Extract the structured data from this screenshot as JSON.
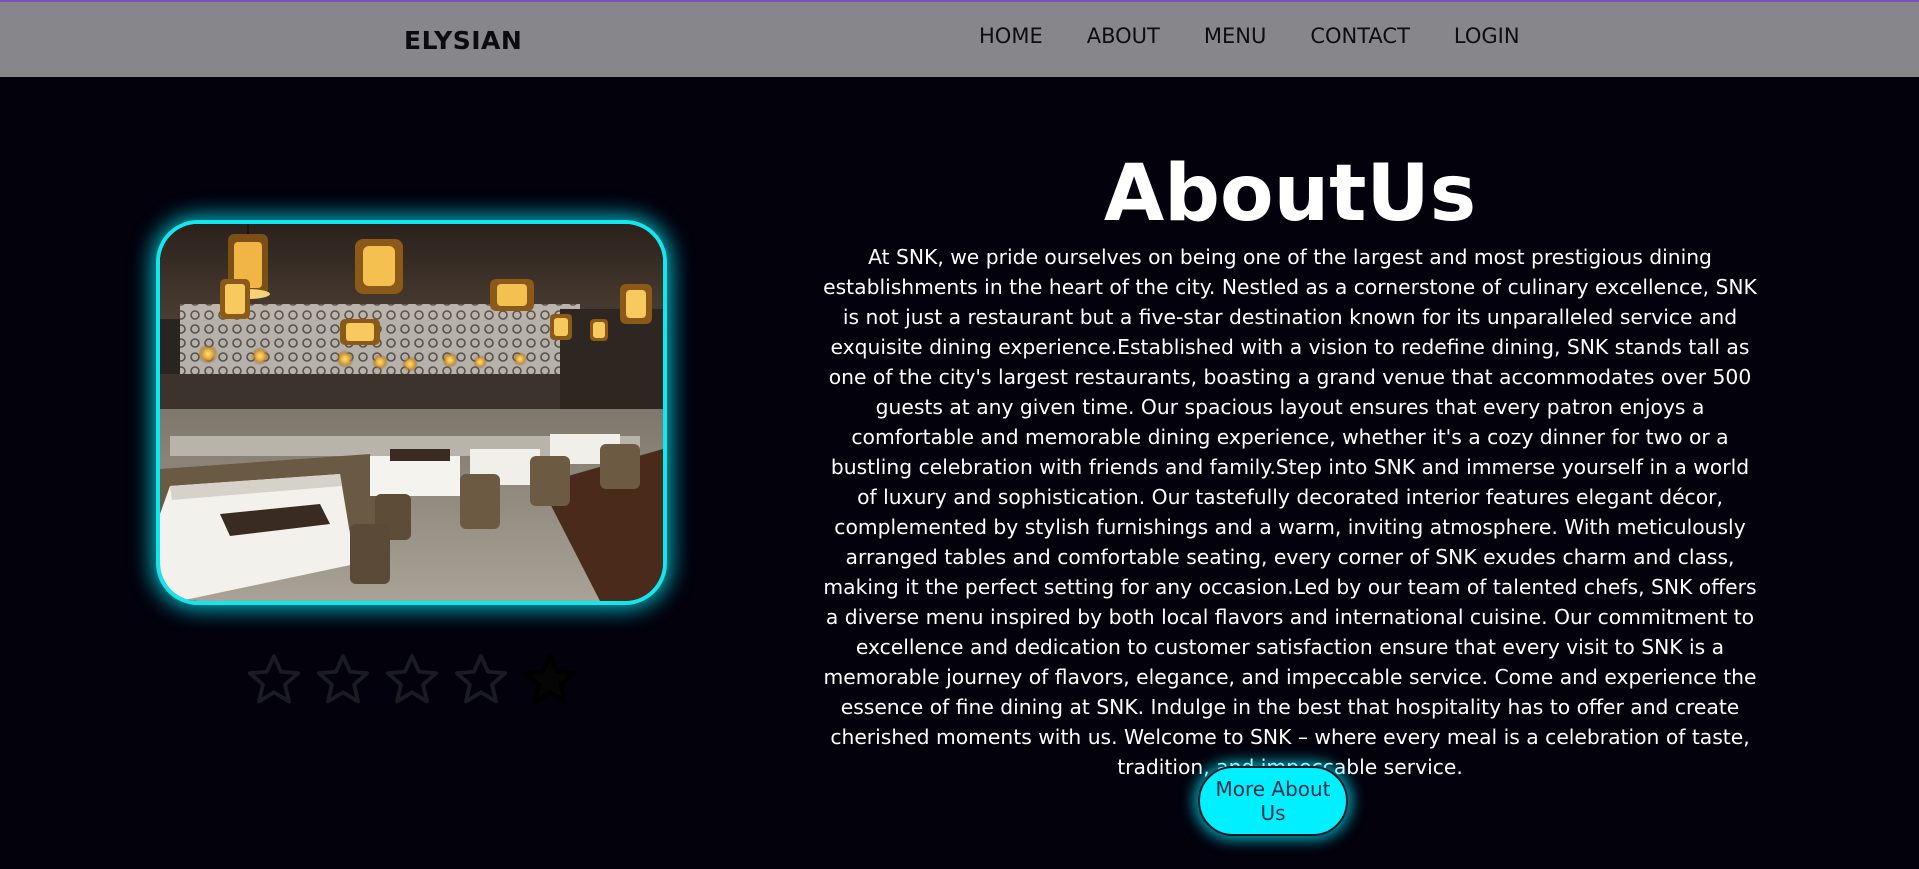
{
  "header": {
    "brand": "ELYSIAN",
    "nav": [
      {
        "label": "HOME"
      },
      {
        "label": "ABOUT"
      },
      {
        "label": "MENU"
      },
      {
        "label": "CONTACT"
      },
      {
        "label": "LOGIN"
      }
    ]
  },
  "about": {
    "title": "AboutUs",
    "body": "At SNK, we pride ourselves on being one of the largest and most prestigious dining establishments in the heart of the city. Nestled as a cornerstone of culinary excellence, SNK is not just a restaurant but a five-star destination known for its unparalleled service and exquisite dining experience.Established with a vision to redefine dining, SNK stands tall as one of the city's largest restaurants, boasting a grand venue that accommodates over 500 guests at any given time. Our spacious layout ensures that every patron enjoys a comfortable and memorable dining experience, whether it's a cozy dinner for two or a bustling celebration with friends and family.Step into SNK and immerse yourself in a world of luxury and sophistication. Our tastefully decorated interior features elegant décor, complemented by stylish furnishings and a warm, inviting atmosphere. With meticulously arranged tables and comfortable seating, every corner of SNK exudes charm and class, making it the perfect setting for any occasion.Led by our team of talented chefs, SNK offers a diverse menu inspired by both local flavors and international cuisine. Our commitment to excellence and dedication to customer satisfaction ensure that every visit to SNK is a memorable journey of flavors, elegance, and impeccable service. Come and experience the essence of fine dining at SNK. Indulge in the best that hospitality has to offer and create cherished moments with us. Welcome to SNK – where every meal is a celebration of taste, tradition, and impeccable service.",
    "button_label": "More About Us"
  },
  "rating": {
    "max": 5,
    "icon": "star-icon",
    "outline_color": "#1b1b22"
  },
  "colors": {
    "accent_cyan": "#00f0ff",
    "page_bg": "#02010c",
    "navbar_bg": "#86868b"
  },
  "image": {
    "icon": "restaurant-interior-photo"
  }
}
